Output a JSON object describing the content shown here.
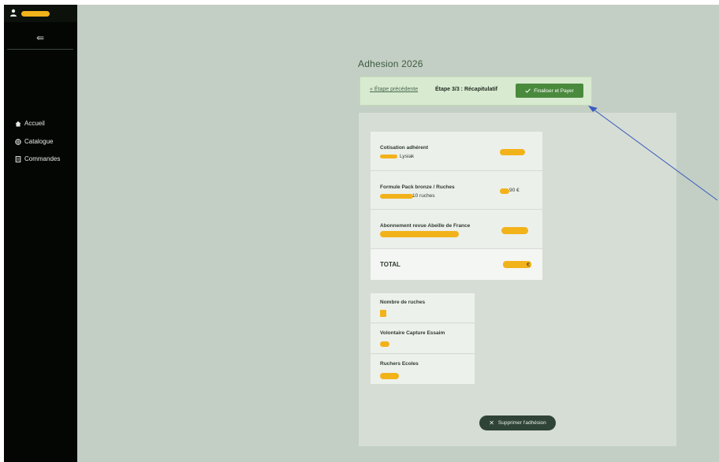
{
  "sidebar": {
    "icons": {
      "user": "user-icon",
      "collapse": "collapse-icon"
    },
    "items": [
      {
        "label": "Accueil",
        "icon": "home-icon"
      },
      {
        "label": "Catalogue",
        "icon": "catalog-icon"
      },
      {
        "label": "Commandes",
        "icon": "orders-icon"
      }
    ]
  },
  "main": {
    "title": "Adhesion 2026",
    "stepbar": {
      "prev_label": "« Étape précédente",
      "step_label": "Étape 3/3 : Récapitulatif",
      "pay_label": "Finaliser et Payer",
      "pay_icon": "check-icon"
    },
    "summary": {
      "rows": [
        {
          "label": "Cotisation adhérent",
          "sub": "Lysiak",
          "price": ""
        },
        {
          "label": "Formule Pack bronze / Ruches",
          "sub": "10 ruches",
          "price": "90 €"
        },
        {
          "label": "Abonnement revue Abeille de France",
          "sub": "",
          "price": ""
        }
      ],
      "total_label": "TOTAL",
      "total_price": "€"
    },
    "info": {
      "rows": [
        {
          "label": "Nombre de ruches"
        },
        {
          "label": "Volontaire Capture Essaim"
        },
        {
          "label": "Ruchers Ecoles"
        }
      ]
    },
    "delete_label": "Supprimer l'adhésion",
    "delete_icon": "close-icon"
  },
  "colors": {
    "background": "#c3cfc4",
    "sidebar": "#040604",
    "accent_green": "#4a8a3d",
    "redaction": "#f2b21a",
    "annotation_arrow": "#3a5bbf"
  }
}
